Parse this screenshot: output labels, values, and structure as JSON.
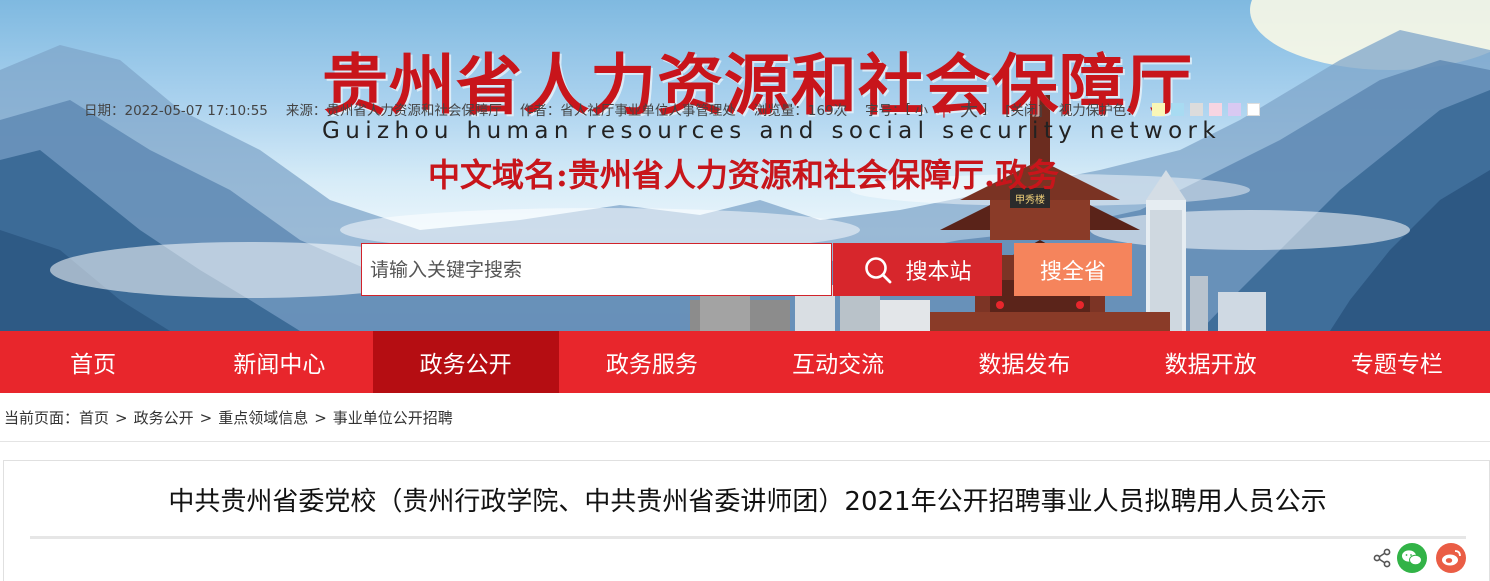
{
  "header": {
    "title": "贵州省人力资源和社会保障厅",
    "subtitle": "Guizhou human resources and social security network",
    "domain": "中文域名:贵州省人力资源和社会保障厅.政务",
    "building_sign": "甲秀楼"
  },
  "search": {
    "placeholder": "请输入关键字搜索",
    "value": "",
    "site_button": "搜本站",
    "all_button": "搜全省"
  },
  "nav": {
    "items": [
      "首页",
      "新闻中心",
      "政务公开",
      "政务服务",
      "互动交流",
      "数据发布",
      "数据开放",
      "专题专栏"
    ],
    "active": "政务公开"
  },
  "breadcrumb": {
    "prefix": "当前页面：",
    "items": [
      "首页",
      "政务公开",
      "重点领域信息",
      "事业单位公开招聘"
    ],
    "separator": ">"
  },
  "article": {
    "title": "中共贵州省委党校（贵州行政学院、中共贵州省委讲师团）2021年公开招聘事业人员拟聘用人员公示",
    "date": "日期：2022-05-07 17:10:55",
    "source": "来源：贵州省人力资源和社会保障厅",
    "author": "作者：省人社厅事业单位人事管理处",
    "views": "浏览量：169次",
    "font_size_label": "字号：",
    "font_open": "[",
    "font_small": "小",
    "font_mid": "中",
    "font_big": "大",
    "font_close": "]",
    "close_label": "[关闭]",
    "eye_label": "视力保护色：",
    "swatch_colors": [
      "#faf7b7",
      "#a8dbf2",
      "#dcdcdc",
      "#f7d5e2",
      "#d9c9f2",
      "#ffffff"
    ]
  },
  "colors": {
    "brand_red": "#e8262c",
    "nav_active": "#b50d12",
    "search_all": "#f5845c",
    "title_red": "#c8151b"
  },
  "icons": [
    "search-icon",
    "share-icon",
    "wechat-icon",
    "weibo-icon"
  ]
}
